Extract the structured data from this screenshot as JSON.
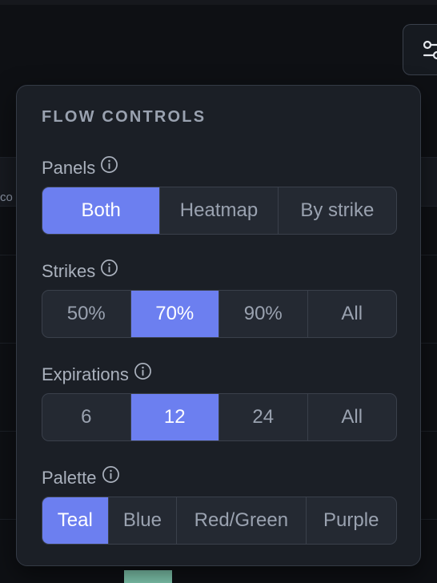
{
  "popover": {
    "title": "FLOW CONTROLS",
    "sections": [
      {
        "label": "Panels",
        "options": [
          "Both",
          "Heatmap",
          "By strike"
        ],
        "selected": "Both"
      },
      {
        "label": "Strikes",
        "options": [
          "50%",
          "70%",
          "90%",
          "All"
        ],
        "selected": "70%"
      },
      {
        "label": "Expirations",
        "options": [
          "6",
          "12",
          "24",
          "All"
        ],
        "selected": "12"
      },
      {
        "label": "Palette",
        "options": [
          "Teal",
          "Blue",
          "Red/Green",
          "Purple"
        ],
        "selected": "Teal"
      }
    ]
  },
  "background": {
    "header_fragment": "co"
  },
  "colors": {
    "accent": "#6c7ff0",
    "panel_bg": "#1b1f26",
    "teal_swatch": "#7fc6ad"
  },
  "icons": {
    "settings_button": "sliders-icon",
    "info": "info-icon"
  }
}
